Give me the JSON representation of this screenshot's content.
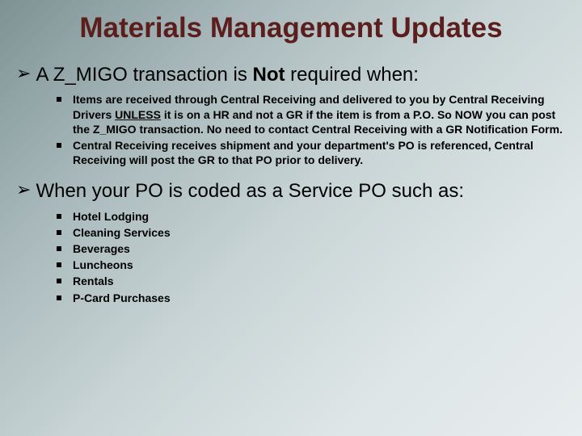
{
  "title": "Materials Management Updates",
  "sections": [
    {
      "heading_pre": "A Z_MIGO transaction is ",
      "heading_bold": "Not",
      "heading_post": " required when:",
      "items": [
        {
          "pre": "Items are received through Central Receiving and delivered to you by Central Receiving Drivers ",
          "underline": "UNLESS",
          "post": " it is on a HR and not a GR if the item is from a P.O. So NOW  you can post the Z_MIGO transaction.  No need to contact Central Receiving with a GR Notification Form."
        },
        {
          "pre": "Central Receiving receives shipment and your department's PO is referenced, Central Receiving will post the GR to that PO prior to delivery.",
          "underline": "",
          "post": ""
        }
      ]
    },
    {
      "heading_pre": "When your PO is coded as a Service PO such as:",
      "heading_bold": "",
      "heading_post": "",
      "items": [
        {
          "pre": "Hotel Lodging",
          "underline": "",
          "post": ""
        },
        {
          "pre": "Cleaning Services",
          "underline": "",
          "post": ""
        },
        {
          "pre": "Beverages",
          "underline": "",
          "post": ""
        },
        {
          "pre": "Luncheons",
          "underline": "",
          "post": ""
        },
        {
          "pre": "Rentals",
          "underline": "",
          "post": ""
        },
        {
          "pre": "P-Card Purchases",
          "underline": "",
          "post": ""
        }
      ]
    }
  ]
}
